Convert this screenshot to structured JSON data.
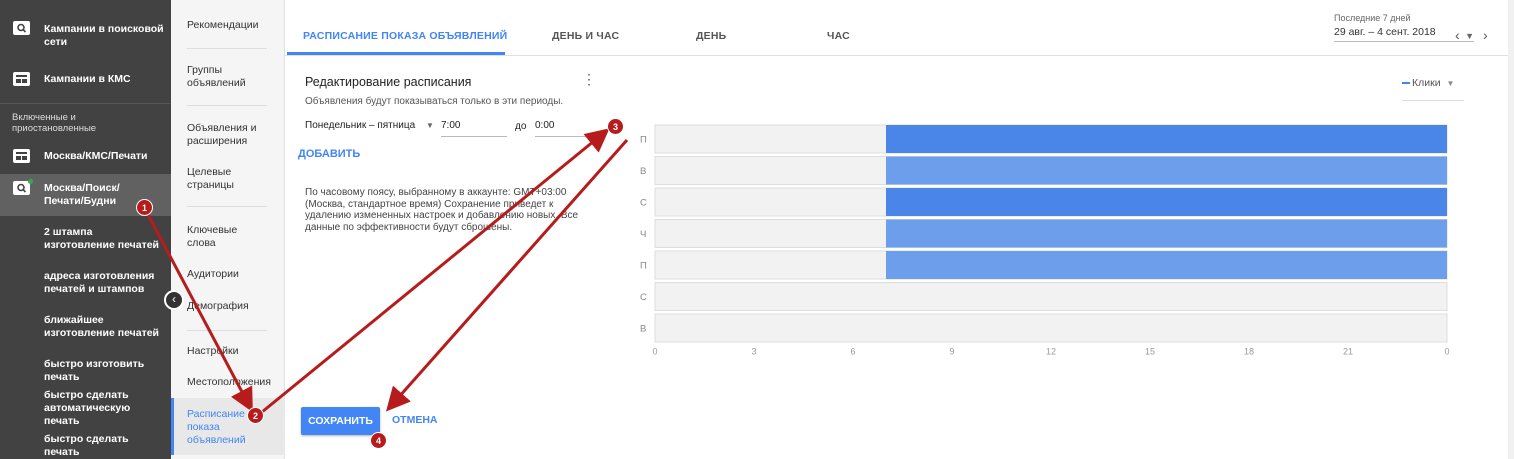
{
  "left_nav": {
    "items": [
      {
        "label": "Кампании в поисковой сети",
        "icon": "search-icon"
      },
      {
        "label": "Кампании в КМС",
        "icon": "display-icon"
      }
    ],
    "section_label": "Включенные и приостановленные",
    "campaigns": [
      {
        "label": "Москва/КМС/Печати",
        "icon": "display-icon"
      },
      {
        "label": "Москва/Поиск/Печати/Будни",
        "icon": "search-icon"
      }
    ],
    "ad_groups": [
      "2 штампа изготовление печатей",
      "адреса изготовления печатей и штампов",
      "ближайшее изготовление печатей",
      "быстро изготовить печать",
      "быстро сделать автоматическую печать",
      "быстро сделать печать"
    ],
    "collapse_glyph": "‹"
  },
  "page_menu": {
    "items": [
      "Рекомендации",
      "Группы объявлений",
      "Объявления и расширения",
      "Целевые страницы",
      "Ключевые слова",
      "Аудитории",
      "Демография",
      "Настройки",
      "Местоположения"
    ],
    "active": "Расписание показа объявлений"
  },
  "tabs": [
    "РАСПИСАНИЕ ПОКАЗА ОБЪЯВЛЕНИЙ",
    "ДЕНЬ И ЧАС",
    "ДЕНЬ",
    "ЧАС"
  ],
  "date_range": {
    "label": "Последние 7 дней",
    "value": "29 авг. – 4 сент. 2018",
    "caret": "▼",
    "prev": "‹",
    "next": "›"
  },
  "editor": {
    "title": "Редактирование расписания",
    "subtitle": "Объявления будут показываться только в эти периоды.",
    "menu_glyph": "⋮",
    "day_select": "Понедельник – пятница",
    "day_caret": "▼",
    "from_time": "7:00",
    "to_label": "до",
    "to_time": "0:00",
    "add_link": "ДОБАВИТЬ",
    "tz_note": "По часовому поясу, выбранному в аккаунте: GMT+03:00 (Москва, стандартное время) Сохранение приведет к удалению измененных настроек и добавлению новых. Все данные по эффективности будут сброшены."
  },
  "metric_select": {
    "label": "Клики",
    "caret": "▼"
  },
  "chart_data": {
    "type": "bar",
    "orientation": "horizontal",
    "categories": [
      "П",
      "В",
      "С",
      "Ч",
      "П",
      "С",
      "В"
    ],
    "series": [
      {
        "name": "Клики",
        "ranges": [
          [
            7,
            24
          ],
          [
            7,
            24
          ],
          [
            7,
            24
          ],
          [
            7,
            24
          ],
          [
            7,
            24
          ],
          null,
          null
        ],
        "shades": [
          "#4a86e8",
          "#6d9eeb",
          "#4a86e8",
          "#6d9eeb",
          "#6d9eeb",
          null,
          null
        ]
      }
    ],
    "x_ticks": [
      "0",
      "3",
      "6",
      "9",
      "12",
      "15",
      "18",
      "21",
      "0"
    ],
    "xlim": [
      0,
      24
    ],
    "colors": {
      "inactive": "#f2f2f2",
      "inactive_border": "#dddddd"
    }
  },
  "buttons": {
    "save": "СОХРАНИТЬ",
    "cancel": "ОТМЕНА"
  },
  "annotations": [
    "1",
    "2",
    "3",
    "4"
  ],
  "colors": {
    "accent": "#4285f4",
    "sidebar": "#424242",
    "annotation": "#b71c1c"
  }
}
